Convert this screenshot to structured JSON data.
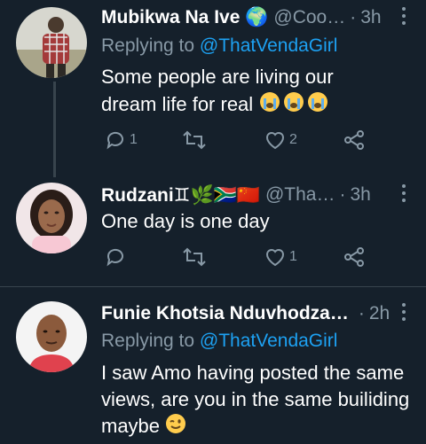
{
  "tweets": [
    {
      "name": "Mubikwa Na Ive 🌍",
      "handle": "@Coo…",
      "time": "3h",
      "replying_prefix": "Replying to",
      "replying_to": "@ThatVendaGirl",
      "text": "Some people are living our dream life for real",
      "reply_count": "1",
      "retweet_count": "",
      "like_count": "2"
    },
    {
      "name": "Rudzani♊🌿🇿🇦🇨🇳",
      "handle": "@Tha…",
      "time": "3h",
      "text": "One day is one day",
      "reply_count": "",
      "retweet_count": "",
      "like_count": "1"
    },
    {
      "name": "Funie Khotsia Nduvhodza…",
      "handle": "",
      "time": "2h",
      "replying_prefix": "Replying to",
      "replying_to": "@ThatVendaGirl",
      "text_line1": "I saw Amo having posted the same",
      "text_line2": "views, are you in the same builiding",
      "text_line3": "maybe"
    }
  ],
  "dot": "·",
  "colors": {
    "background": "#15202b",
    "secondary": "#8899a6",
    "accent": "#1da1f2",
    "border": "#38444d"
  },
  "icons": [
    "reply-icon",
    "retweet-icon",
    "like-icon",
    "share-icon",
    "more-icon"
  ]
}
